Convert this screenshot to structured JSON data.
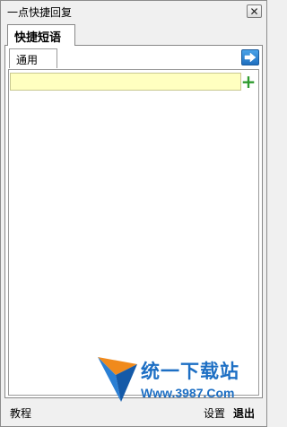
{
  "window": {
    "title": "一点快捷回复"
  },
  "tabs": {
    "main": "快捷短语",
    "category": "通用"
  },
  "input": {
    "value": ""
  },
  "watermark": {
    "title": "统一下载站",
    "url": "Www.3987.Com"
  },
  "footer": {
    "tutorial": "教程",
    "settings": "设置",
    "exit": "退出"
  },
  "colors": {
    "input_bg": "#ffffc0",
    "accent": "#1d6fc4",
    "add": "#2e9b2e"
  }
}
